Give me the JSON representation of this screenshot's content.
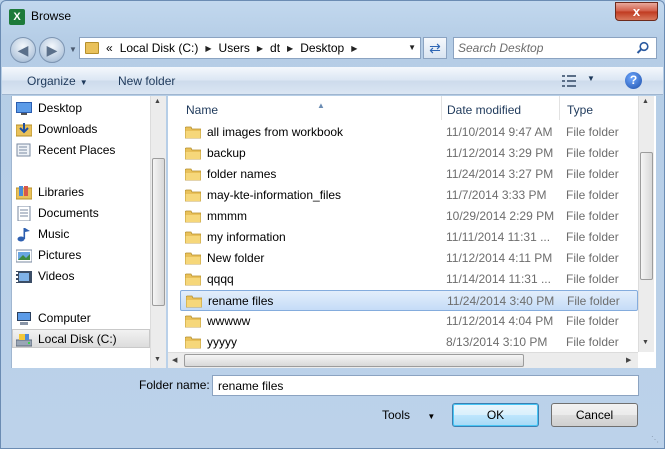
{
  "window": {
    "title": "Browse",
    "app_icon": "X",
    "close": "x"
  },
  "address": {
    "overflow": "«",
    "crumbs": [
      "Local Disk (C:)",
      "Users",
      "dt",
      "Desktop"
    ],
    "search_placeholder": "Search Desktop"
  },
  "toolbar": {
    "organize_label": "Organize",
    "new_folder_label": "New folder",
    "help_label": "?"
  },
  "nav": {
    "items": [
      {
        "label": "Desktop",
        "icon": "desktop-icon"
      },
      {
        "label": "Downloads",
        "icon": "downloads-icon"
      },
      {
        "label": "Recent Places",
        "icon": "recent-places-icon"
      },
      {
        "label": "Libraries",
        "icon": "libraries-icon"
      },
      {
        "label": "Documents",
        "icon": "documents-icon"
      },
      {
        "label": "Music",
        "icon": "music-icon"
      },
      {
        "label": "Pictures",
        "icon": "pictures-icon"
      },
      {
        "label": "Videos",
        "icon": "videos-icon"
      },
      {
        "label": "Computer",
        "icon": "computer-icon"
      },
      {
        "label": "Local Disk (C:)",
        "icon": "drive-icon",
        "selected": true
      }
    ]
  },
  "files": {
    "columns": {
      "name": "Name",
      "date": "Date modified",
      "type": "Type"
    },
    "rows": [
      {
        "name": "all images from workbook",
        "date": "11/10/2014 9:47 AM",
        "type": "File folder"
      },
      {
        "name": "backup",
        "date": "11/12/2014 3:29 PM",
        "type": "File folder"
      },
      {
        "name": "folder names",
        "date": "11/24/2014 3:27 PM",
        "type": "File folder"
      },
      {
        "name": "may-kte-information_files",
        "date": "11/7/2014 3:33 PM",
        "type": "File folder"
      },
      {
        "name": "mmmm",
        "date": "10/29/2014 2:29 PM",
        "type": "File folder"
      },
      {
        "name": "my information",
        "date": "11/11/2014 11:31 ...",
        "type": "File folder"
      },
      {
        "name": "New folder",
        "date": "11/12/2014 4:11 PM",
        "type": "File folder"
      },
      {
        "name": "qqqq",
        "date": "11/14/2014 11:31 ...",
        "type": "File folder"
      },
      {
        "name": "rename files",
        "date": "11/24/2014 3:40 PM",
        "type": "File folder",
        "selected": true
      },
      {
        "name": "wwwww",
        "date": "11/12/2014 4:04 PM",
        "type": "File folder"
      },
      {
        "name": "yyyyy",
        "date": "8/13/2014 3:10 PM",
        "type": "File folder"
      }
    ]
  },
  "bottom": {
    "folder_name_label": "Folder name:",
    "folder_name_value": "rename files",
    "tools_label": "Tools",
    "ok_label": "OK",
    "cancel_label": "Cancel"
  }
}
